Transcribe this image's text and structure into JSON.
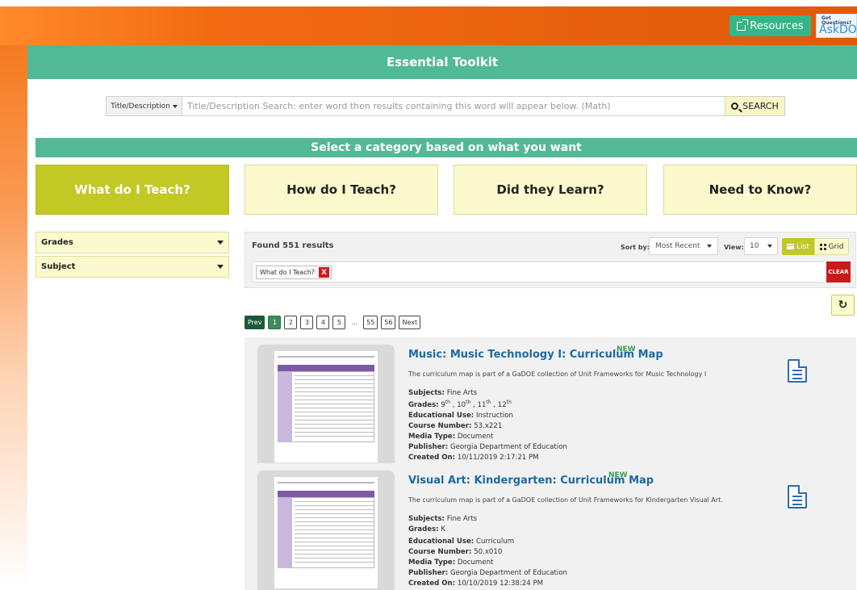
{
  "header": {
    "resources_label": "Resources",
    "askdoe_small": "Got Questions?",
    "askdoe_big": "AskDOE"
  },
  "page": {
    "title": "Essential Toolkit",
    "category_heading": "Select a category based on what you want"
  },
  "search": {
    "field_select": "Title/Description",
    "placeholder": "Title/Description Search:  enter word then results containing this word will appear below. (Math)",
    "button_label": "SEARCH"
  },
  "categories": [
    {
      "label": "What do I Teach?",
      "active": true
    },
    {
      "label": "How do I Teach?",
      "active": false
    },
    {
      "label": "Did they Learn?",
      "active": false
    },
    {
      "label": "Need to Know?",
      "active": false
    }
  ],
  "filters": [
    {
      "label": "Grades"
    },
    {
      "label": "Subject"
    }
  ],
  "results_bar": {
    "found_text": "Found 551 results",
    "sort_label": "Sort by:",
    "sort_value": "Most Recent",
    "view_label": "View:",
    "view_value": "10",
    "list_label": "List",
    "grid_label": "Grid",
    "active_tag": "What do I Teach?",
    "tag_remove": "X",
    "clear_label": "CLEAR"
  },
  "pagination": {
    "prev": "Prev",
    "pages": [
      "1",
      "2",
      "3",
      "4",
      "5"
    ],
    "current": "1",
    "ellipsis": "...",
    "tail_pages": [
      "55",
      "56"
    ],
    "next": "Next"
  },
  "results": [
    {
      "title": "Music: Music Technology I: Curriculum Map",
      "badge": "NEW",
      "description": "The curriculum map is part of a GaDOE collection of Unit Frameworks for Music Technology I",
      "subjects_label": "Subjects:",
      "subjects": "Fine Arts",
      "grades_label": "Grades:",
      "grades": [
        {
          "num": "9",
          "sup": "th"
        },
        {
          "num": "10",
          "sup": "th"
        },
        {
          "num": "11",
          "sup": "th"
        },
        {
          "num": "12",
          "sup": "th"
        }
      ],
      "use_label": "Educational Use:",
      "use": "Instruction",
      "course_label": "Course Number:",
      "course": "53.x221",
      "media_label": "Media Type:",
      "media": "Document",
      "publisher_label": "Publisher:",
      "publisher": "Georgia Department of Education",
      "created_label": "Created On:",
      "created": "10/11/2019 2:17:21 PM",
      "icon": "document-icon"
    },
    {
      "title": "Visual Art: Kindergarten: Curriculum Map",
      "badge": "NEW",
      "description": "The curriculum map is part of a GaDOE collection of Unit Frameworks for Kindergarten Visual Art.",
      "subjects_label": "Subjects:",
      "subjects": "Fine Arts",
      "grades_label": "Grades:",
      "grades_text": "K",
      "use_label": "Educational Use:",
      "use": "Curriculum",
      "course_label": "Course Number:",
      "course": "50.x010",
      "media_label": "Media Type:",
      "media": "Document",
      "publisher_label": "Publisher:",
      "publisher": "Georgia Department of Education",
      "created_label": "Created On:",
      "created": "10/10/2019 12:38:24 PM",
      "icon": "document-icon"
    }
  ],
  "colors": {
    "orange_band": "#e0590a",
    "teal": "#52b996",
    "lime_active": "#c2c824",
    "pale_yellow": "#fafacc",
    "link_blue": "#1d6aa4",
    "clear_red": "#c8191b"
  }
}
